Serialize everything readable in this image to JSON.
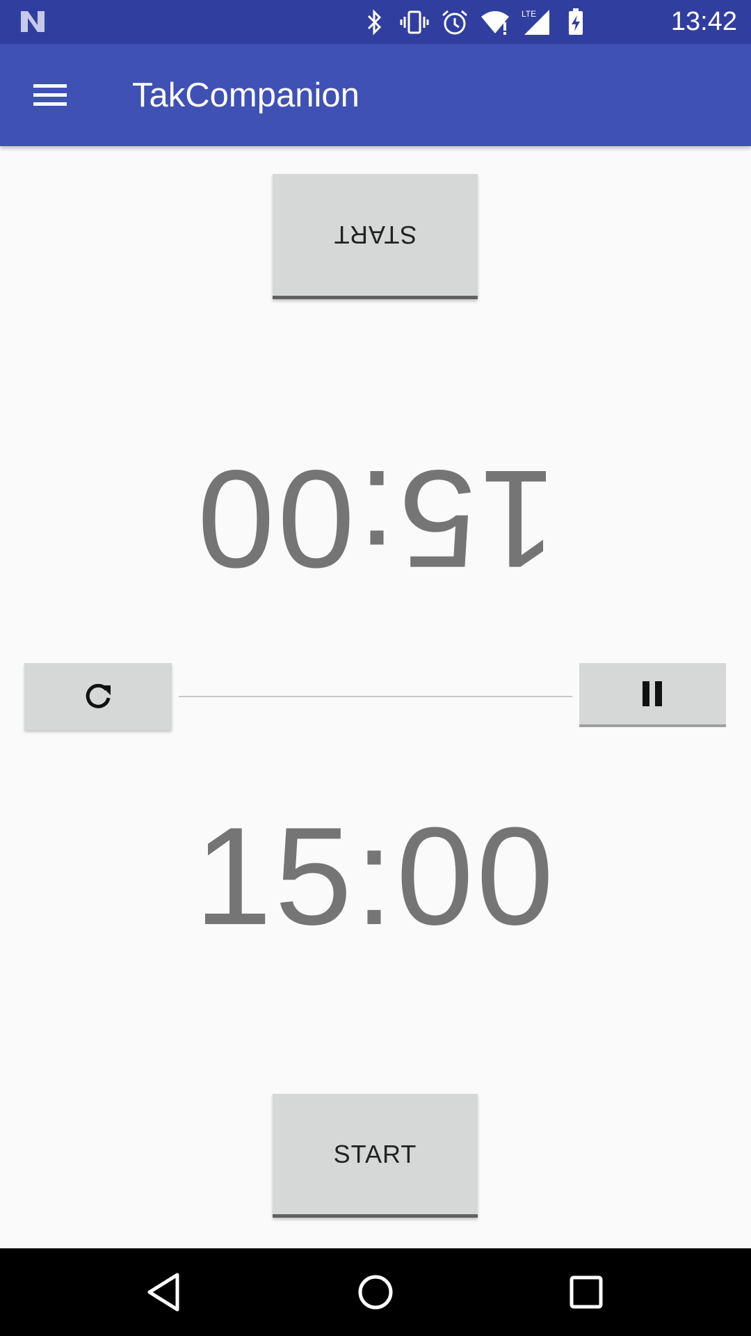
{
  "status_bar": {
    "time": "13:42",
    "icons": [
      "android-n-icon",
      "bluetooth-icon",
      "vibrate-icon",
      "alarm-icon",
      "wifi-icon",
      "lte-signal-icon",
      "battery-charging-icon"
    ],
    "lte_label": "LTE"
  },
  "app_bar": {
    "title": "TakCompanion",
    "menu_icon": "hamburger-menu-icon"
  },
  "top_player": {
    "start_label": "START",
    "timer": "15:00"
  },
  "controls": {
    "reset_icon": "refresh-icon",
    "pause_icon": "pause-icon"
  },
  "bottom_player": {
    "timer": "15:00",
    "start_label": "START"
  },
  "nav_bar": {
    "icons": [
      "back-icon",
      "home-icon",
      "recents-icon"
    ]
  },
  "colors": {
    "status_bar": "#303f9f",
    "app_bar": "#3f51b5",
    "button": "#d6d7d7",
    "timer_text": "#757575",
    "background": "#fafafa"
  }
}
